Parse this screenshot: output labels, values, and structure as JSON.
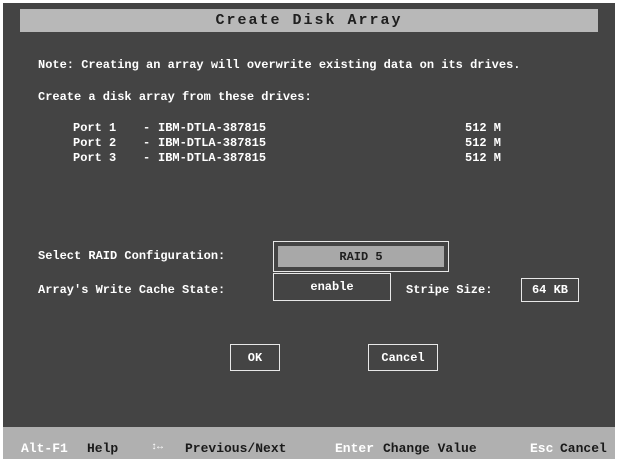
{
  "window": {
    "title": "Create Disk Array"
  },
  "note": "Note: Creating an array will overwrite existing data on its drives.",
  "drives_heading": "Create a disk array from these drives:",
  "drives": [
    {
      "port": "Port 1",
      "sep": "-",
      "model": "IBM-DTLA-387815",
      "size": "512 M"
    },
    {
      "port": "Port 2",
      "sep": "-",
      "model": "IBM-DTLA-387815",
      "size": "512 M"
    },
    {
      "port": "Port 3",
      "sep": "-",
      "model": "IBM-DTLA-387815",
      "size": "512 M"
    }
  ],
  "raid": {
    "label": "Select RAID Configuration:",
    "value": "RAID 5"
  },
  "cache": {
    "label": "Array's Write Cache State:",
    "value": "enable"
  },
  "stripe": {
    "label": "Stripe Size:",
    "value": "64 KB"
  },
  "buttons": {
    "ok": "OK",
    "cancel": "Cancel"
  },
  "status": {
    "help_key": "Alt-F1",
    "help_desc": "Help",
    "nav_key": "↕↔",
    "nav_desc": "Previous/Next",
    "change_key": "Enter",
    "change_desc": "Change Value",
    "cancel_key": "Esc",
    "cancel_desc": "Cancel"
  },
  "colors": {
    "background": "#444444",
    "titlebar": "#b8b8b8",
    "highlight": "#a8a8a8",
    "text": "#ffffff"
  }
}
